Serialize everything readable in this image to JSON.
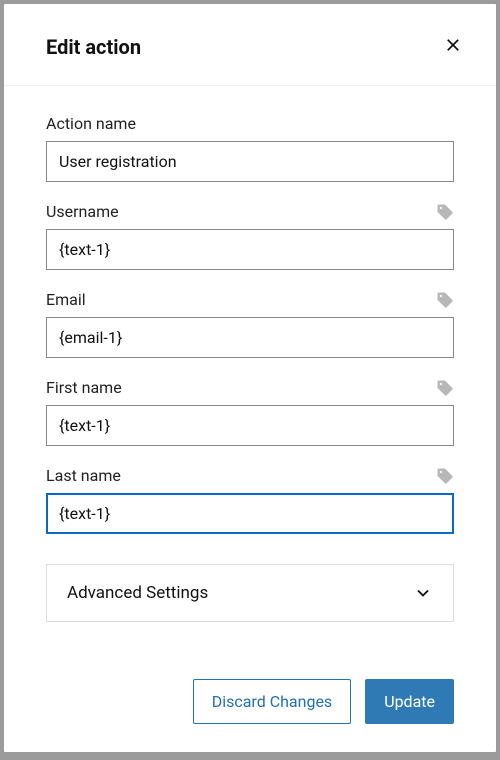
{
  "modal": {
    "title": "Edit action"
  },
  "fields": {
    "action_name": {
      "label": "Action name",
      "value": "User registration",
      "has_tag": false
    },
    "username": {
      "label": "Username",
      "value": "{text-1}",
      "has_tag": true
    },
    "email": {
      "label": "Email",
      "value": "{email-1}",
      "has_tag": true
    },
    "first_name": {
      "label": "First name",
      "value": "{text-1}",
      "has_tag": true
    },
    "last_name": {
      "label": "Last name",
      "value": "{text-1}",
      "has_tag": true,
      "focused": true
    }
  },
  "advanced": {
    "label": "Advanced Settings"
  },
  "footer": {
    "discard_label": "Discard Changes",
    "update_label": "Update"
  }
}
